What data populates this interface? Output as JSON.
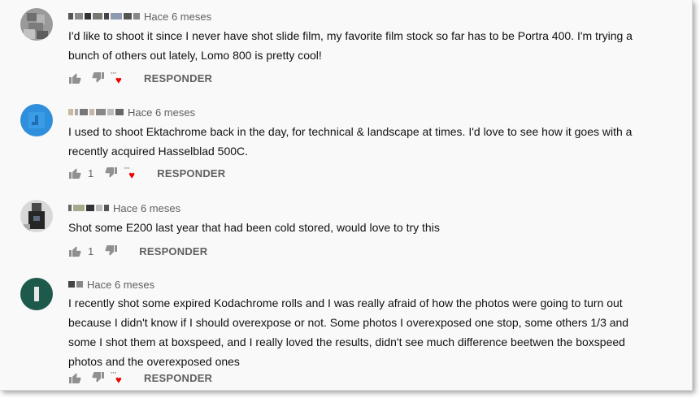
{
  "comments": [
    {
      "time": "Hace 6 meses",
      "text": "I'd like to shoot it since I never have shot slide film, my favorite film stock so far has to be Portra 400. I'm trying a bunch of others out lately, Lomo 800 is pretty cool!",
      "likes": "",
      "reply_label": "RESPONDER",
      "avatar_color": "#8a8a8a"
    },
    {
      "time": "Hace 6 meses",
      "text": "I used to shoot Ektachrome back in the day, for technical & landscape at times. I'd love to see how it goes with a recently acquired Hasselblad 500C.",
      "likes": "1",
      "reply_label": "RESPONDER",
      "avatar_color": "#2f8fdc"
    },
    {
      "time": "Hace 6 meses",
      "text": "Shot some E200 last year that had been cold stored, would love to try this",
      "likes": "1",
      "reply_label": "RESPONDER",
      "avatar_color": "#3a3a3a"
    },
    {
      "time": "Hace 6 meses",
      "text": "I recently shot some expired Kodachrome rolls and I was really afraid of how the photos were going to turn out because I didn't know if I should overexpose or not. Some photos I overexposed one stop, some others 1/3 and some I shot them at boxspeed, and I really loved the results, didn't see much difference beetwen the boxspeed photos and the overexposed ones",
      "likes": "",
      "reply_label": "RESPONDER",
      "avatar_color": "#1e5a4c"
    }
  ],
  "colors": {
    "heart": "#e00000",
    "meta": "#606060",
    "text": "#111111"
  },
  "icons": [
    "thumbs-up-icon",
    "thumbs-down-icon",
    "creator-heart-icon"
  ]
}
